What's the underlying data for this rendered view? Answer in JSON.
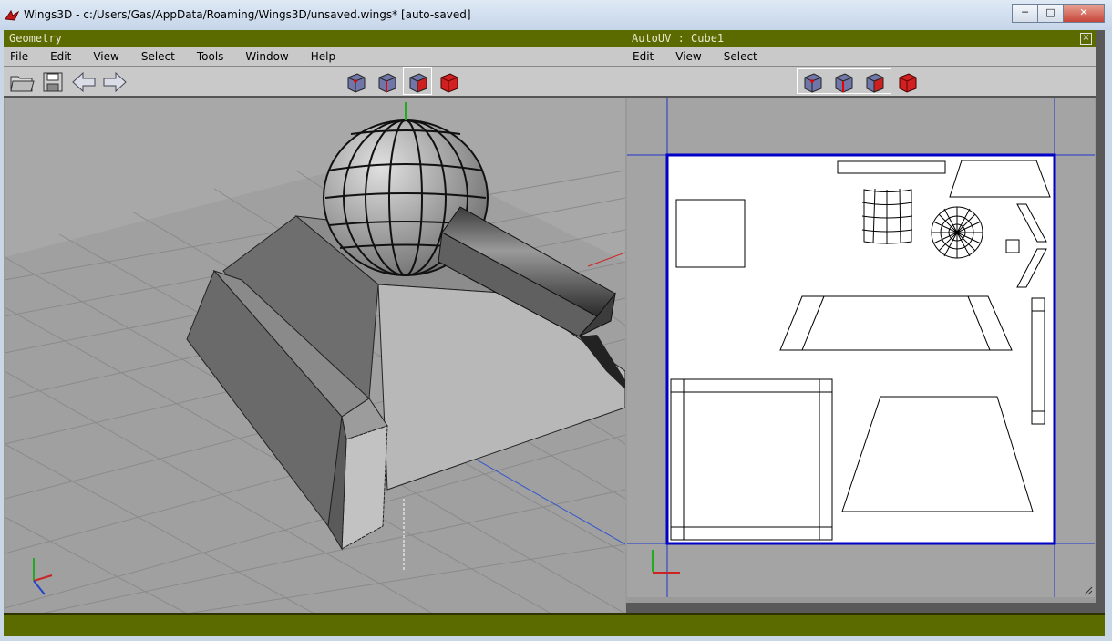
{
  "window": {
    "title": "Wings3D - c:/Users/Gas/AppData/Roaming/Wings3D/unsaved.wings* [auto-saved]",
    "controls": [
      "─",
      "□",
      "✕"
    ]
  },
  "geometry_panel": {
    "title": "Geometry",
    "menu": [
      "File",
      "Edit",
      "View",
      "Select",
      "Tools",
      "Window",
      "Help"
    ]
  },
  "autouv_panel": {
    "title": "AutoUV : Cube1",
    "menu": [
      "Edit",
      "View",
      "Select"
    ],
    "close_glyph": "×"
  },
  "colors": {
    "title_bar": "#5c6b00",
    "selection_red": "#cc2020",
    "uv_border": "#0000c8",
    "viewport_bg": "#a8a8a8"
  },
  "icons": {
    "toolbar_left": [
      "open-folder-icon",
      "save-disk-icon",
      "undo-arrow-icon",
      "redo-arrow-icon"
    ],
    "selection_modes": [
      "vertex-select-icon",
      "edge-select-icon",
      "face-select-icon",
      "object-select-icon"
    ]
  }
}
